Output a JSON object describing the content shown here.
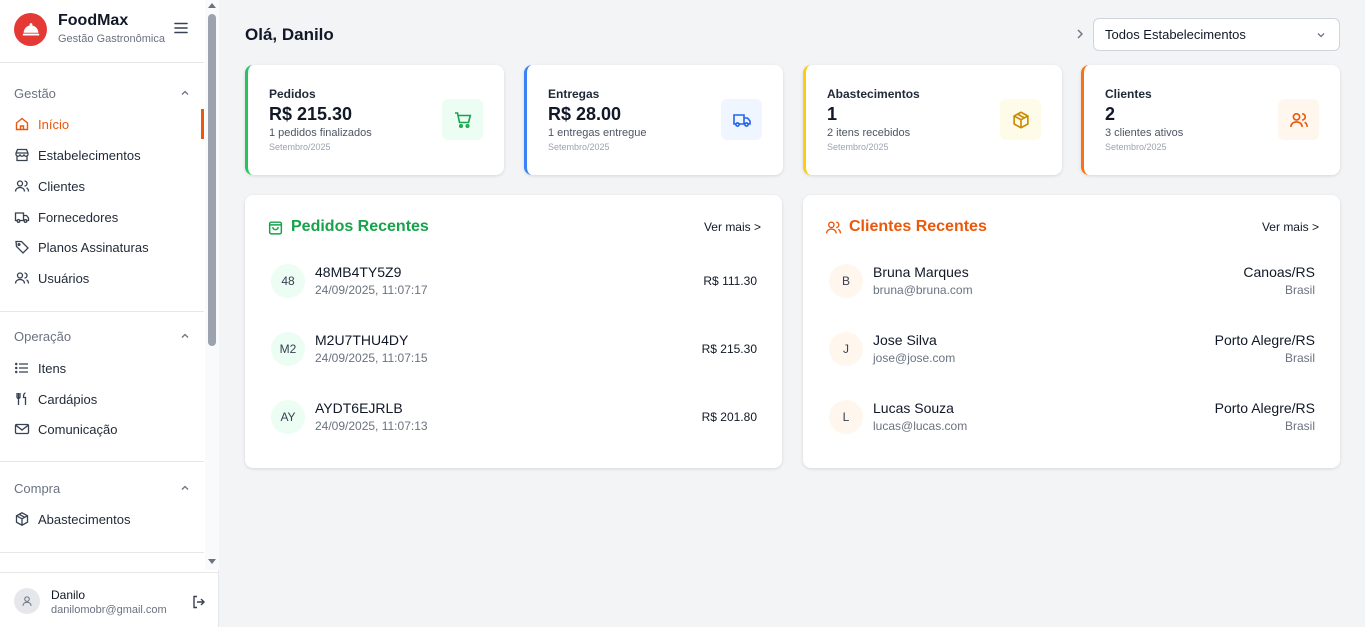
{
  "brand": {
    "name": "FoodMax",
    "subtitle": "Gestão Gastronômica"
  },
  "sidebar": {
    "sections": [
      {
        "label": "Gestão",
        "items": [
          {
            "label": "Início",
            "icon": "home-icon",
            "active": true
          },
          {
            "label": "Estabelecimentos",
            "icon": "store-icon"
          },
          {
            "label": "Clientes",
            "icon": "users-icon"
          },
          {
            "label": "Fornecedores",
            "icon": "truck-icon"
          },
          {
            "label": "Planos Assinaturas",
            "icon": "tag-icon"
          },
          {
            "label": "Usuários",
            "icon": "user-group-icon"
          }
        ]
      },
      {
        "label": "Operação",
        "items": [
          {
            "label": "Itens",
            "icon": "list-icon"
          },
          {
            "label": "Cardápios",
            "icon": "utensils-icon"
          },
          {
            "label": "Comunicação",
            "icon": "mail-icon"
          }
        ]
      },
      {
        "label": "Compra",
        "items": [
          {
            "label": "Abastecimentos",
            "icon": "package-icon"
          }
        ]
      }
    ]
  },
  "user": {
    "name": "Danilo",
    "email": "danilomobr@gmail.com"
  },
  "header": {
    "greeting": "Olá, Danilo",
    "establishment_select": "Todos Estabelecimentos"
  },
  "colors": {
    "accent": "#ea580c",
    "green": "#16a34a",
    "blue": "#2563eb",
    "yellow": "#ca8a04",
    "orange": "#ea580c"
  },
  "cards": [
    {
      "title": "Pedidos",
      "value": "R$ 215.30",
      "sub": "1 pedidos finalizados",
      "date": "Setembro/2025",
      "icon": "cart-icon"
    },
    {
      "title": "Entregas",
      "value": "R$ 28.00",
      "sub": "1 entregas entregue",
      "date": "Setembro/2025",
      "icon": "truck-icon"
    },
    {
      "title": "Abastecimentos",
      "value": "1",
      "sub": "2 itens recebidos",
      "date": "Setembro/2025",
      "icon": "package-icon"
    },
    {
      "title": "Clientes",
      "value": "2",
      "sub": "3 clientes ativos",
      "date": "Setembro/2025",
      "icon": "users-icon"
    }
  ],
  "recent_orders": {
    "title": "Pedidos Recentes",
    "more": "Ver mais >",
    "rows": [
      {
        "initials": "48",
        "code": "48MB4TY5Z9",
        "datetime": "24/09/2025, 11:07:17",
        "amount": "R$ 111.30"
      },
      {
        "initials": "M2",
        "code": "M2U7THU4DY",
        "datetime": "24/09/2025, 11:07:15",
        "amount": "R$ 215.30"
      },
      {
        "initials": "AY",
        "code": "AYDT6EJRLB",
        "datetime": "24/09/2025, 11:07:13",
        "amount": "R$ 201.80"
      }
    ]
  },
  "recent_clients": {
    "title": "Clientes Recentes",
    "more": "Ver mais >",
    "rows": [
      {
        "initial": "B",
        "name": "Bruna Marques",
        "email": "bruna@bruna.com",
        "city": "Canoas/RS",
        "country": "Brasil"
      },
      {
        "initial": "J",
        "name": "Jose Silva",
        "email": "jose@jose.com",
        "city": "Porto Alegre/RS",
        "country": "Brasil"
      },
      {
        "initial": "L",
        "name": "Lucas Souza",
        "email": "lucas@lucas.com",
        "city": "Porto Alegre/RS",
        "country": "Brasil"
      }
    ]
  }
}
